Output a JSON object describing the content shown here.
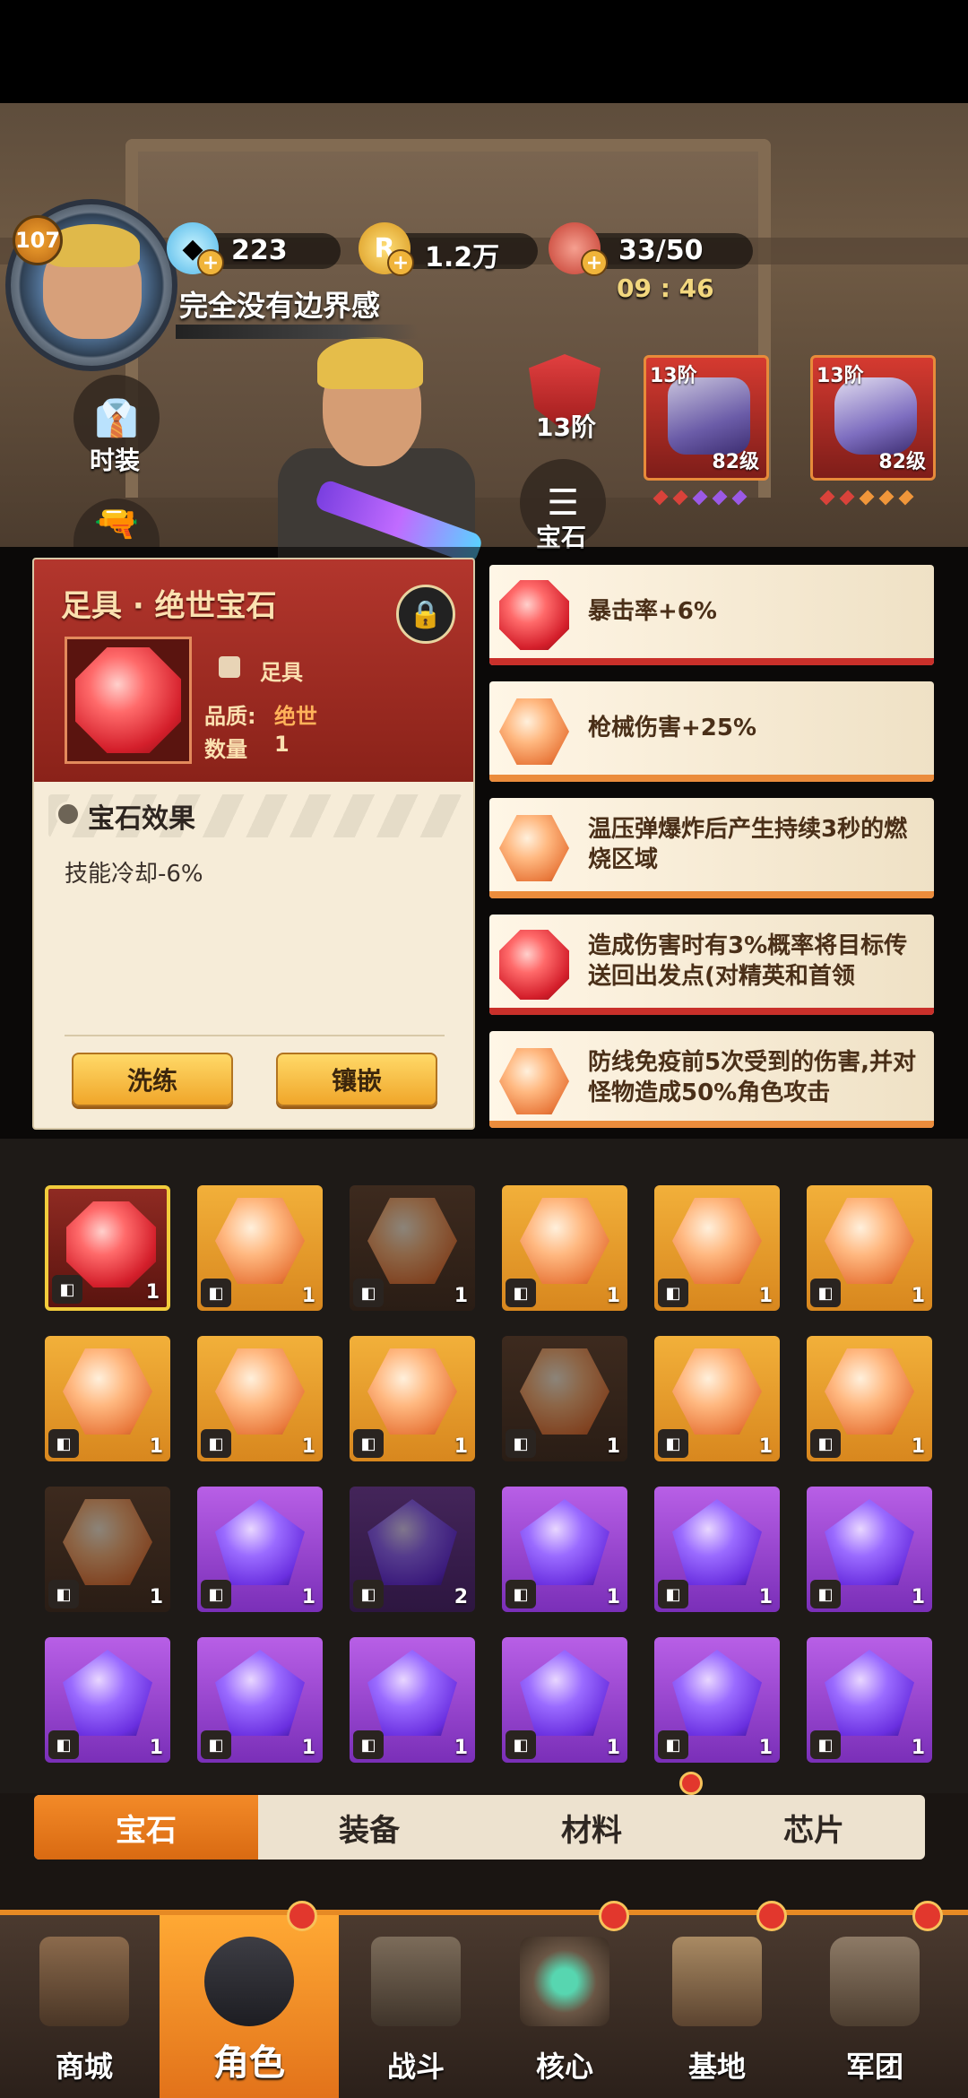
{
  "player": {
    "level": "107",
    "name": "完全没有边界感"
  },
  "resources": {
    "gems": "223",
    "coins": "1.2万",
    "stamina": "33/50",
    "timer": "09 : 46"
  },
  "side_buttons": {
    "costume": "时装",
    "gem": "宝石"
  },
  "rank": {
    "label": "13阶"
  },
  "equip_cards": [
    {
      "tier": "13阶",
      "level": "82级"
    },
    {
      "tier": "13阶",
      "level": "82级"
    }
  ],
  "detail": {
    "title": "足具 · 绝世宝石",
    "slot": "足具",
    "quality_label": "品质:",
    "quality_value": "绝世",
    "count_label": "数量",
    "count_value": "1",
    "effect_title": "宝石效果",
    "effect_text": "技能冷却-6%",
    "btn_reroll": "洗练",
    "btn_inlay": "镶嵌"
  },
  "effects": [
    {
      "gem": "red",
      "text": "暴击率+6%"
    },
    {
      "gem": "orange",
      "text": "枪械伤害+25%"
    },
    {
      "gem": "orange",
      "text": "温压弹爆炸后产生持续3秒的燃烧区域"
    },
    {
      "gem": "red",
      "text": "造成伤害时有3%概率将目标传送回出发点(对精英和首领"
    },
    {
      "gem": "orange",
      "text": "防线免疫前5次受到的伤害,并对怪物造成50%角色攻击"
    }
  ],
  "inventory": [
    {
      "type": "red",
      "icon": "boot-icon",
      "count": "1"
    },
    {
      "type": "orange",
      "icon": "boot-icon",
      "count": "1"
    },
    {
      "type": "dark",
      "icon": "boot-icon",
      "count": "1"
    },
    {
      "type": "orange",
      "icon": "boot-icon",
      "count": "1"
    },
    {
      "type": "orange",
      "icon": "boot-icon",
      "count": "1"
    },
    {
      "type": "orange",
      "icon": "boot-icon",
      "count": "1"
    },
    {
      "type": "orange",
      "icon": "boot-icon",
      "count": "1"
    },
    {
      "type": "orange",
      "icon": "knife-icon",
      "count": "1"
    },
    {
      "type": "orange",
      "icon": "knife-icon",
      "count": "1"
    },
    {
      "type": "dark",
      "icon": "pants-icon",
      "count": "1"
    },
    {
      "type": "orange",
      "icon": "pants-icon",
      "count": "1"
    },
    {
      "type": "orange",
      "icon": "glove-icon",
      "count": "1"
    },
    {
      "type": "dark",
      "icon": "glove-icon",
      "count": "1"
    },
    {
      "type": "purple",
      "icon": "helmet-icon",
      "count": "1"
    },
    {
      "type": "darkp",
      "icon": "helmet-icon",
      "count": "2"
    },
    {
      "type": "purple",
      "icon": "helmet-icon",
      "count": "1"
    },
    {
      "type": "purple",
      "icon": "boot-icon",
      "count": "1"
    },
    {
      "type": "purple",
      "icon": "boot-icon",
      "count": "1"
    },
    {
      "type": "purple",
      "icon": "boot-icon",
      "count": "1"
    },
    {
      "type": "purple",
      "icon": "boot-icon",
      "count": "1"
    },
    {
      "type": "purple",
      "icon": "boot-icon",
      "count": "1"
    },
    {
      "type": "purple",
      "icon": "boot-icon",
      "count": "1"
    },
    {
      "type": "purple",
      "icon": "knife-icon",
      "count": "1"
    },
    {
      "type": "purple",
      "icon": "knife-icon",
      "count": "1"
    }
  ],
  "tabs": [
    "宝石",
    "装备",
    "材料",
    "芯片"
  ],
  "nav": [
    "商城",
    "角色",
    "战斗",
    "核心",
    "基地",
    "军团"
  ],
  "colors": {
    "accent": "#f38a28",
    "gem_red": "#d41f2b",
    "gem_orange": "#e9793c",
    "gem_purple": "#6a2fe0"
  }
}
